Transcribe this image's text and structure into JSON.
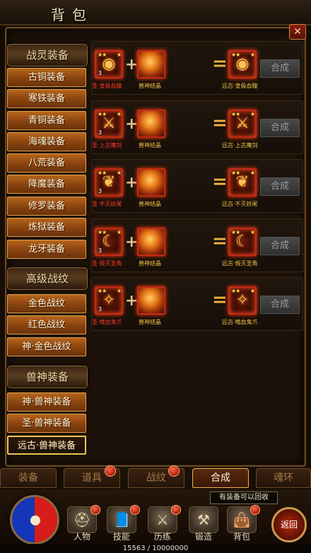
{
  "window": {
    "title": "背包",
    "close_label": "✕"
  },
  "sidebar": {
    "groups": [
      {
        "title": "战灵装备",
        "items": [
          "古铜装备",
          "寒铁装备",
          "青铜装备",
          "海魂装备",
          "八荒装备",
          "降魔装备",
          "修罗装备",
          "炼狱装备",
          "龙牙装备"
        ]
      },
      {
        "title": "高级战纹",
        "items": [
          "金色战纹",
          "红色战纹",
          "神·金色战纹"
        ]
      },
      {
        "title": "兽神装备",
        "items": [
          "神·兽神装备",
          "圣·兽神装备",
          "远古·兽神装备"
        ]
      }
    ],
    "selected": "远古·兽神装备"
  },
  "recipes": [
    {
      "input_name": "圣·皇极血瞳",
      "material_name": "兽神结晶",
      "output_name": "远古·皇极血瞳",
      "input_level": "3",
      "input_icon": "eye-amulet-icon",
      "button": "合成"
    },
    {
      "input_name": "圣·上古魔剑",
      "material_name": "兽神结晶",
      "output_name": "远古·上古魔剑",
      "input_level": "3",
      "input_icon": "sword-icon",
      "button": "合成"
    },
    {
      "input_name": "圣·不灭妖尾",
      "material_name": "兽神结晶",
      "output_name": "远古·不灭妖尾",
      "input_level": "3",
      "input_icon": "tail-icon",
      "button": "合成"
    },
    {
      "input_name": "圣·毁灭圣角",
      "material_name": "兽神结晶",
      "output_name": "远古·毁灭圣角",
      "input_level": "3",
      "input_icon": "horn-icon",
      "button": "合成"
    },
    {
      "input_name": "圣·嗜血鬼爪",
      "material_name": "兽神结晶",
      "output_name": "远古·嗜血鬼爪",
      "input_level": "3",
      "input_icon": "claw-icon",
      "button": "合成"
    }
  ],
  "tabs": [
    {
      "label": "装备",
      "badge": false
    },
    {
      "label": "道具",
      "badge": true
    },
    {
      "label": "战纹",
      "badge": true
    },
    {
      "label": "合成",
      "badge": false,
      "active": true
    },
    {
      "label": "魂环",
      "badge": false
    }
  ],
  "hud": {
    "tooltip": "有装备可以回收",
    "menu": [
      {
        "label": "人物",
        "icon": "helmet-icon",
        "badge": true
      },
      {
        "label": "技能",
        "icon": "skill-book-icon",
        "badge": true
      },
      {
        "label": "历练",
        "icon": "warrior-icon",
        "badge": true
      },
      {
        "label": "锻造",
        "icon": "anvil-icon",
        "badge": false
      },
      {
        "label": "背包",
        "icon": "bag-icon",
        "badge": true
      }
    ],
    "back_label": "返回",
    "exp_text": "15563 / 10000000"
  },
  "colors": {
    "accent": "#f1c453",
    "red_name": "#ff3a2a",
    "gold_name": "#f2c24a"
  }
}
